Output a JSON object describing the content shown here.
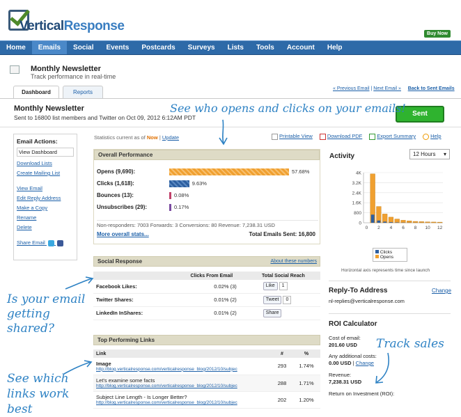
{
  "brand": {
    "logo_text_a": "Vertical",
    "logo_text_b": "Response",
    "buy_now": "Buy Now"
  },
  "nav": [
    "Home",
    "Emails",
    "Social",
    "Events",
    "Postcards",
    "Surveys",
    "Lists",
    "Tools",
    "Account",
    "Help"
  ],
  "nav_active": "Emails",
  "page": {
    "title": "Monthly Newsletter",
    "subtitle": "Track performance in real-time"
  },
  "tabs": {
    "dashboard": "Dashboard",
    "reports": "Reports"
  },
  "top_links": {
    "prev": "« Previous Email",
    "sep": "|",
    "next": "Next Email »",
    "back": "Back to Sent Emails"
  },
  "newsletter": {
    "title": "Monthly Newsletter",
    "sent_line": "Sent to 16800 list members and Twitter on Oct 09, 2012 6:12AM PDT",
    "status": "Sent"
  },
  "sidebar": {
    "heading": "Email Actions:",
    "selected": "View Dashboard",
    "group1": [
      "Download Lists",
      "Create Mailing List"
    ],
    "group2": [
      "View Email",
      "Edit Reply Address",
      "Make a Copy",
      "Rename",
      "Delete"
    ],
    "share": "Share Email"
  },
  "stats": {
    "prefix": "Statistics current as of",
    "now": "Now",
    "sep": "|",
    "update": "Update"
  },
  "actions": {
    "print": "Printable View",
    "pdf": "Download PDF",
    "export": "Export Summary",
    "help": "Help"
  },
  "overall": {
    "heading": "Overall Performance",
    "rows": [
      {
        "label": "Opens (9,690):",
        "pct": "57.68%",
        "value": 57.68,
        "color": "#f0a030"
      },
      {
        "label": "Clicks (1,618):",
        "pct": "9.63%",
        "value": 9.63,
        "color": "#2d5fa0"
      },
      {
        "label": "Bounces (13):",
        "pct": "0.08%",
        "value": 0.08,
        "color": "#c0406a"
      },
      {
        "label": "Unsubscribes (29):",
        "pct": "0.17%",
        "value": 0.17,
        "color": "#7a4aa0"
      }
    ],
    "footer": "Non-responders: 7003 Forwards: 3 Conversions: 80 Revenue: 7,238.31 USD",
    "more": "More overall stats...",
    "total_label": "Total Emails Sent:",
    "total_value": "16,800"
  },
  "social": {
    "heading": "Social Response",
    "about": "About these numbers",
    "col_clicks": "Clicks From Email",
    "col_reach": "Total Social Reach",
    "rows": [
      {
        "label": "Facebook Likes:",
        "clicks": "0.02% (3)",
        "btn": "Like",
        "count": "1"
      },
      {
        "label": "Twitter Shares:",
        "clicks": "0.01% (2)",
        "btn": "Tweet",
        "count": "0"
      },
      {
        "label": "LinkedIn InShares:",
        "clicks": "0.01% (2)",
        "btn": "Share",
        "count": ""
      }
    ]
  },
  "links": {
    "heading": "Top Performing Links",
    "col_link": "Link",
    "col_num": "#",
    "col_pct": "%",
    "rows": [
      {
        "title": "Image",
        "url": "http://blog.verticalresponse.com/verticalresponse_blog/2012/10/subjec",
        "num": "293",
        "pct": "1.74%"
      },
      {
        "title": "Let's examine some facts",
        "url": "http://blog.verticalresponse.com/verticalresponse_blog/2012/10/subjec",
        "num": "288",
        "pct": "1.71%"
      },
      {
        "title": "Subject Line Length - Is Longer Better?",
        "url": "http://blog.verticalresponse.com/verticalresponse_blog/2012/10/subjec",
        "num": "202",
        "pct": "1.20%"
      }
    ]
  },
  "activity": {
    "heading": "Activity",
    "select": "12 Hours",
    "axis_note": "Horizontal axis represents time since launch",
    "legend": [
      "Clicks",
      "Opens"
    ]
  },
  "chart_data": {
    "type": "bar",
    "categories": [
      "0",
      "1",
      "2",
      "3",
      "4",
      "5",
      "6",
      "7",
      "8",
      "9",
      "10",
      "11",
      "12"
    ],
    "series": [
      {
        "name": "Clicks",
        "values": [
          0,
          650,
          180,
          90,
          50,
          30,
          20,
          15,
          10,
          8,
          5,
          4,
          3
        ]
      },
      {
        "name": "Opens",
        "values": [
          0,
          3900,
          1300,
          700,
          450,
          300,
          200,
          150,
          110,
          90,
          70,
          60,
          50
        ]
      }
    ],
    "yticks": [
      "4K",
      "3.2K",
      "2.4K",
      "1.6K",
      "800",
      "0"
    ],
    "xticks": [
      "0",
      "2",
      "4",
      "6",
      "8",
      "10",
      "12"
    ],
    "ylim": [
      0,
      4000
    ],
    "colors": {
      "Clicks": "#2d5fa0",
      "Opens": "#f0a030"
    }
  },
  "reply": {
    "heading": "Reply-To Address",
    "change": "Change",
    "address": "nl-replies@verticalresponse.com"
  },
  "roi": {
    "heading": "ROI Calculator",
    "cost_label": "Cost of email:",
    "cost_value": "201.60 USD",
    "add_label": "Any additional costs:",
    "add_value": "0.00 USD",
    "sep": "|",
    "add_change": "Change",
    "revenue_label": "Revenue:",
    "revenue_value": "7,238.31 USD",
    "roi_label": "Return on Investment (ROI):"
  },
  "annotations": {
    "opens": "See who opens and clicks on your emails!",
    "shared": "Is your email getting shared?",
    "links": "See which links work best",
    "sales": "Track sales"
  }
}
